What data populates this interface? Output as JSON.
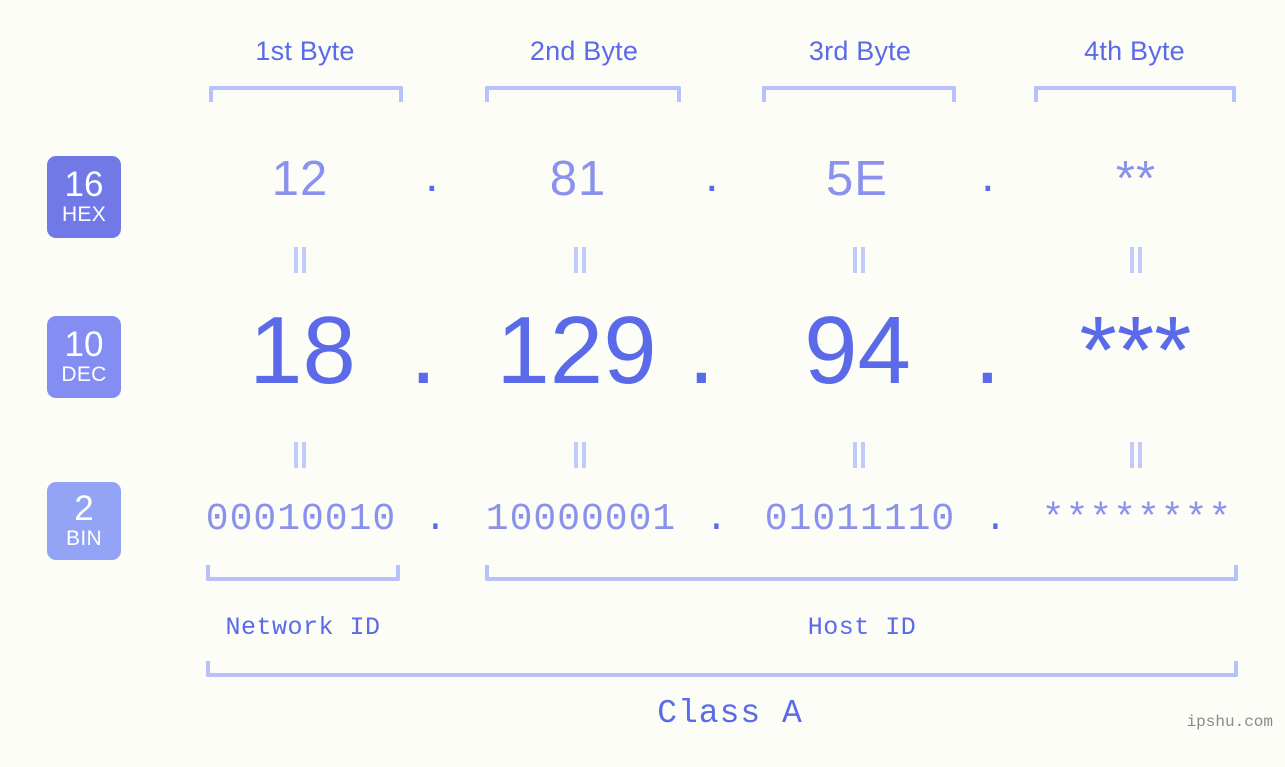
{
  "background_color": "#fcfdf7",
  "accent_color": "#5b6ae8",
  "accent_light_color": "#8b92ee",
  "bracket_color": "#b9c1fb",
  "byte_headers": [
    {
      "label": "1st Byte"
    },
    {
      "label": "2nd Byte"
    },
    {
      "label": "3rd Byte"
    },
    {
      "label": "4th Byte"
    }
  ],
  "bases": [
    {
      "number": "16",
      "name": "HEX",
      "color": "#7079e6"
    },
    {
      "number": "10",
      "name": "DEC",
      "color": "#848ef2"
    },
    {
      "number": "2",
      "name": "BIN",
      "color": "#93a3f6"
    }
  ],
  "rows": {
    "hex": {
      "values": [
        "12",
        "81",
        "5E",
        "**"
      ],
      "separator": "."
    },
    "dec": {
      "values": [
        "18",
        "129",
        "94",
        "***"
      ],
      "separator": "."
    },
    "bin": {
      "values": [
        "00010010",
        "10000001",
        "01011110",
        "********"
      ],
      "separator": "."
    }
  },
  "connectors": {
    "symbol": "equals-rotated"
  },
  "id_ranges": [
    {
      "label": "Network ID"
    },
    {
      "label": "Host ID"
    }
  ],
  "class": {
    "label": "Class A"
  },
  "watermark": {
    "text": "ipshu.com"
  }
}
